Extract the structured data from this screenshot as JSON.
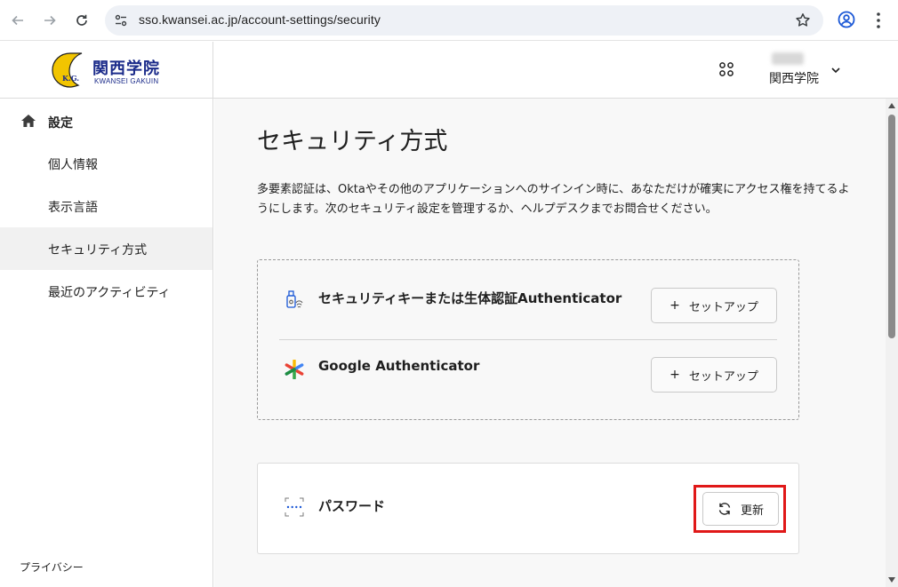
{
  "browser": {
    "url": "sso.kwansei.ac.jp/account-settings/security",
    "icons": [
      "back-icon",
      "forward-icon",
      "reload-icon",
      "site-info-icon",
      "bookmark-star-icon",
      "profile-icon",
      "more-menu-icon"
    ]
  },
  "header": {
    "logo_jp": "関西学院",
    "logo_en": "KWANSEI GAKUIN",
    "user_org": "関西学院",
    "icons": [
      "apps-grid-icon",
      "chevron-down-icon"
    ]
  },
  "sidebar": {
    "home_label": "設定",
    "items": [
      {
        "label": "個人情報"
      },
      {
        "label": "表示言語"
      },
      {
        "label": "セキュリティ方式"
      },
      {
        "label": "最近のアクティビティ"
      }
    ],
    "active_index": 2,
    "footer": "プライバシー"
  },
  "main": {
    "title": "セキュリティ方式",
    "description": "多要素認証は、Oktaやその他のアプリケーションへのサインイン時に、あなただけが確実にアクセス権を持てるようにします。次のセキュリティ設定を管理するか、ヘルプデスクまでお問合せください。",
    "authenticators": [
      {
        "name": "セキュリティキーまたは生体認証Authenticator",
        "icon": "security-key-icon",
        "button": "セットアップ"
      },
      {
        "name": "Google Authenticator",
        "icon": "google-authenticator-icon",
        "button": "セットアップ"
      }
    ],
    "password": {
      "name": "パスワード",
      "icon": "password-icon",
      "button": "更新"
    }
  },
  "colors": {
    "highlight": "#e01818",
    "logo_blue": "#1b2b8a",
    "logo_yellow": "#f2c500"
  }
}
